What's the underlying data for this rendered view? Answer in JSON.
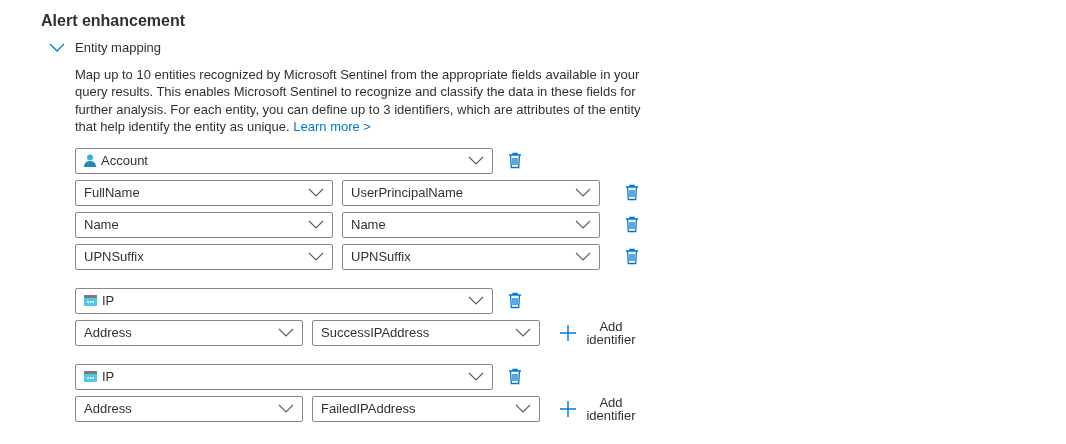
{
  "section": {
    "title": "Alert enhancement"
  },
  "entity_mapping": {
    "label": "Entity mapping",
    "expanded": true,
    "description": "Map up to 10 entities recognized by Microsoft Sentinel from the appropriate fields available in your query results. This enables Microsoft Sentinel to recognize and classify the data in these fields for further analysis. For each entity, you can define up to 3 identifiers, which are attributes of the entity that help identify the entity as unique.",
    "learn_more": "Learn more >",
    "entities": [
      {
        "kind": "account",
        "type": "Account",
        "identifiers": [
          {
            "identifier": "FullName",
            "column": "UserPrincipalName"
          },
          {
            "identifier": "Name",
            "column": "Name"
          },
          {
            "identifier": "UPNSuffix",
            "column": "UPNSuffix"
          }
        ]
      },
      {
        "kind": "ip",
        "type": "IP",
        "identifiers": [
          {
            "identifier": "Address",
            "column": "SuccessIPAddress"
          }
        ],
        "add_identifier": "Add identifier"
      },
      {
        "kind": "ip",
        "type": "IP",
        "identifiers": [
          {
            "identifier": "Address",
            "column": "FailedIPAddress"
          }
        ],
        "add_identifier": "Add identifier"
      }
    ]
  }
}
